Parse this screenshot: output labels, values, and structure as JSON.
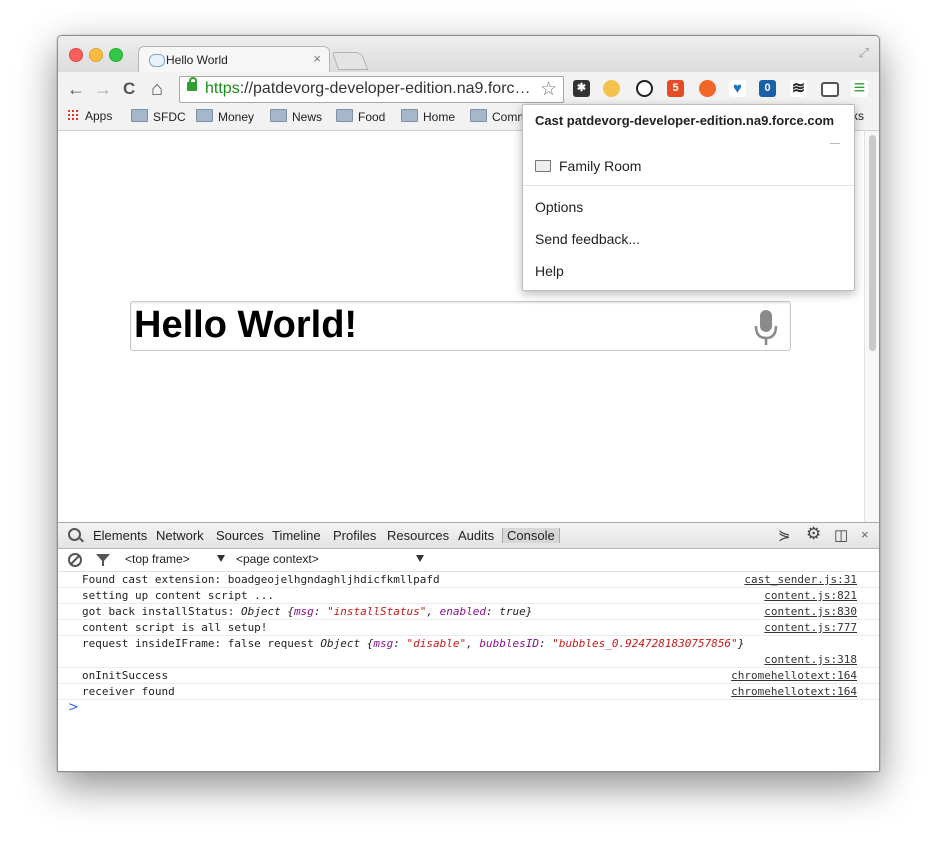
{
  "window": {
    "tab_title": "Hello World",
    "tab_close": "×"
  },
  "toolbar": {
    "url_scheme": "https",
    "url_rest": "://patdevorg-developer-edition.na9.forc…",
    "back_glyph": "←",
    "forward_glyph": "→",
    "reload_glyph": "C",
    "home_glyph": "⌂",
    "star_glyph": "☆",
    "menu_glyph": "≡"
  },
  "bookmarks": [
    {
      "label": "Apps"
    },
    {
      "label": "SFDC"
    },
    {
      "label": "Money"
    },
    {
      "label": "News"
    },
    {
      "label": "Food"
    },
    {
      "label": "Home"
    },
    {
      "label": "Comm"
    }
  ],
  "bookmarks_overflow": "ks",
  "page": {
    "speech_text": "Hello World!"
  },
  "cast_menu": {
    "title": "Cast patdevorg-developer-edition.na9.force.com",
    "device": "Family Room",
    "options": "Options",
    "feedback": "Send feedback...",
    "help": "Help"
  },
  "devtools": {
    "tabs": [
      "Elements",
      "Network",
      "Sources",
      "Timeline",
      "Profiles",
      "Resources",
      "Audits",
      "Console"
    ],
    "frame": "<top frame>",
    "context": "<page context>",
    "close": "×",
    "prompt": ">",
    "log": [
      {
        "text": "Found cast extension: boadgeojelhgndaghljhdicfkmllpafd",
        "source": "cast_sender.js:31"
      },
      {
        "text": "setting up content script ...",
        "source": "content.js:821"
      },
      {
        "text_prefix": "got back installStatus: ",
        "obj": "Object ",
        "brace_open": "{",
        "k1": "msg",
        "sep1": ": ",
        "v1": "\"installStatus\"",
        "comma": ", ",
        "k2": "enabled",
        "sep2": ": ",
        "v2": "true",
        "brace_close": "}",
        "source": "content.js:830"
      },
      {
        "text": "content script is all setup!",
        "source": "content.js:777"
      },
      {
        "text_prefix": "request insideIFrame: false request ",
        "obj": "Object ",
        "brace_open": "{",
        "k1": "msg",
        "sep1": ": ",
        "v1": "\"disable\"",
        "comma": ", ",
        "k2": "bubblesID",
        "sep2": ": ",
        "v2": "\"bubbles_0.9247281830757856\"",
        "brace_close": "}",
        "source": "content.js:318"
      },
      {
        "text": "onInitSuccess",
        "source": "chromehellotext:164"
      },
      {
        "text": "receiver found",
        "source": "chromehellotext:164"
      }
    ]
  },
  "colors": {
    "url_green": "#1a8a1a",
    "console_key": "#881391",
    "console_string": "#c41a16",
    "prompt_blue": "#2a69d6"
  }
}
